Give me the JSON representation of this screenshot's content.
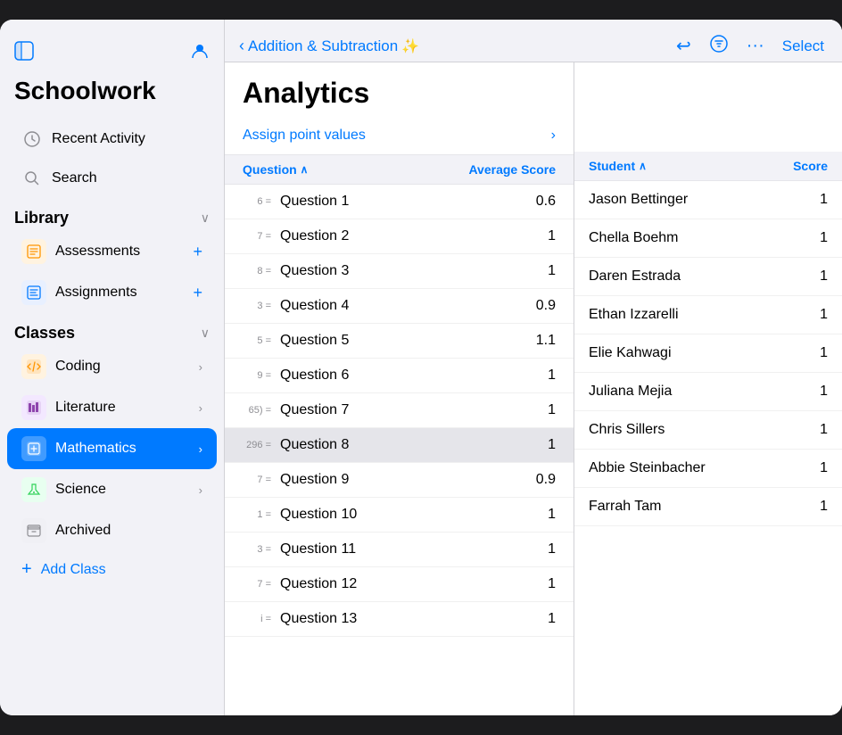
{
  "app": {
    "title": "Schoolwork"
  },
  "sidebar": {
    "toggle_icon": "⊞",
    "avatar_icon": "👤",
    "nav_items": [
      {
        "id": "recent-activity",
        "icon": "🕐",
        "label": "Recent Activity"
      },
      {
        "id": "search",
        "icon": "🔍",
        "label": "Search"
      }
    ],
    "library_section": {
      "title": "Library",
      "items": [
        {
          "id": "assessments",
          "icon": "📊",
          "icon_color": "#ff9500",
          "label": "Assessments"
        },
        {
          "id": "assignments",
          "icon": "📋",
          "icon_color": "#007aff",
          "label": "Assignments"
        }
      ]
    },
    "classes_section": {
      "title": "Classes",
      "items": [
        {
          "id": "coding",
          "icon": "💻",
          "icon_color": "#ff9500",
          "label": "Coding",
          "active": false
        },
        {
          "id": "literature",
          "icon": "📊",
          "icon_color": "#8e44ad",
          "label": "Literature",
          "active": false
        },
        {
          "id": "mathematics",
          "icon": "📋",
          "icon_color": "#007aff",
          "label": "Mathematics",
          "active": true
        },
        {
          "id": "science",
          "icon": "✂️",
          "icon_color": "#30d158",
          "label": "Science",
          "active": false
        }
      ]
    },
    "archived_label": "Archived",
    "add_class_label": "Add Class"
  },
  "main": {
    "nav": {
      "back_label": "Addition & Subtraction",
      "sparkle": "✨",
      "icons": [
        "↩",
        "≡",
        "···"
      ],
      "select_label": "Select"
    },
    "analytics": {
      "title": "Analytics",
      "assign_point_values": "Assign point values",
      "questions_col": "Question",
      "avg_score_col": "Average Score",
      "sort_arrow": "∧",
      "questions": [
        {
          "id": 1,
          "hint": "6 =",
          "label": "Question 1",
          "score": "0.6",
          "selected": false
        },
        {
          "id": 2,
          "hint": "7 =",
          "label": "Question 2",
          "score": "1",
          "selected": false
        },
        {
          "id": 3,
          "hint": "8 =",
          "label": "Question 3",
          "score": "1",
          "selected": false
        },
        {
          "id": 4,
          "hint": "3 =",
          "label": "Question 4",
          "score": "0.9",
          "selected": false
        },
        {
          "id": 5,
          "hint": "5 =",
          "label": "Question 5",
          "score": "1.1",
          "selected": false
        },
        {
          "id": 6,
          "hint": "9 =",
          "label": "Question 6",
          "score": "1",
          "selected": false
        },
        {
          "id": 7,
          "hint": "65) =",
          "label": "Question 7",
          "score": "1",
          "selected": false
        },
        {
          "id": 8,
          "hint": "296 =",
          "label": "Question 8",
          "score": "1",
          "selected": true
        },
        {
          "id": 9,
          "hint": "7 =",
          "label": "Question 9",
          "score": "0.9",
          "selected": false
        },
        {
          "id": 10,
          "hint": "1 =",
          "label": "Question 10",
          "score": "1",
          "selected": false
        },
        {
          "id": 11,
          "hint": "3 =",
          "label": "Question 11",
          "score": "1",
          "selected": false
        },
        {
          "id": 12,
          "hint": "7 =",
          "label": "Question 12",
          "score": "1",
          "selected": false
        },
        {
          "id": 13,
          "hint": "i =",
          "label": "Question 13",
          "score": "1",
          "selected": false
        }
      ]
    },
    "students": {
      "student_col": "Student",
      "score_col": "Score",
      "sort_arrow": "∧",
      "list": [
        {
          "id": 1,
          "name": "Jason Bettinger",
          "score": "1"
        },
        {
          "id": 2,
          "name": "Chella Boehm",
          "score": "1"
        },
        {
          "id": 3,
          "name": "Daren Estrada",
          "score": "1"
        },
        {
          "id": 4,
          "name": "Ethan Izzarelli",
          "score": "1"
        },
        {
          "id": 5,
          "name": "Elie Kahwagi",
          "score": "1"
        },
        {
          "id": 6,
          "name": "Juliana Mejia",
          "score": "1"
        },
        {
          "id": 7,
          "name": "Chris Sillers",
          "score": "1"
        },
        {
          "id": 8,
          "name": "Abbie Steinbacher",
          "score": "1"
        },
        {
          "id": 9,
          "name": "Farrah Tam",
          "score": "1"
        }
      ]
    }
  }
}
